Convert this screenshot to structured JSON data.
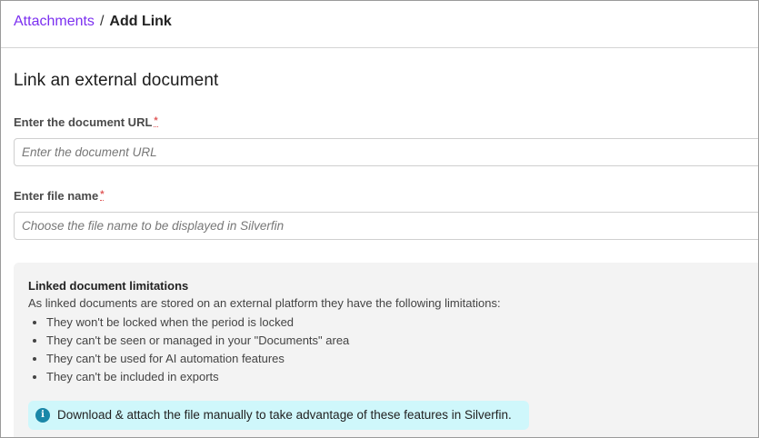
{
  "breadcrumb": {
    "parent": "Attachments",
    "separator": "/",
    "current": "Add Link"
  },
  "page_title": "Link an external document",
  "form": {
    "url": {
      "label": "Enter the document URL",
      "required_mark": "*",
      "placeholder": "Enter the document URL",
      "value": ""
    },
    "file_name": {
      "label": "Enter file name",
      "required_mark": "*",
      "placeholder": "Choose the file name to be displayed in Silverfin",
      "value": ""
    }
  },
  "limitations": {
    "title": "Linked document limitations",
    "description": "As linked documents are stored on an external platform they have the following limitations:",
    "items": [
      "They won't be locked when the period is locked",
      "They can't be seen or managed in your \"Documents\" area",
      "They can't be used for AI automation features",
      "They can't be included in exports"
    ],
    "info": {
      "icon": "info-icon",
      "text": "Download & attach the file manually to take advantage of these features in Silverfin."
    }
  },
  "colors": {
    "link": "#7b2ff0",
    "info_bg": "#cff7fb",
    "info_icon": "#1a87a8",
    "required": "#e05a5a"
  }
}
